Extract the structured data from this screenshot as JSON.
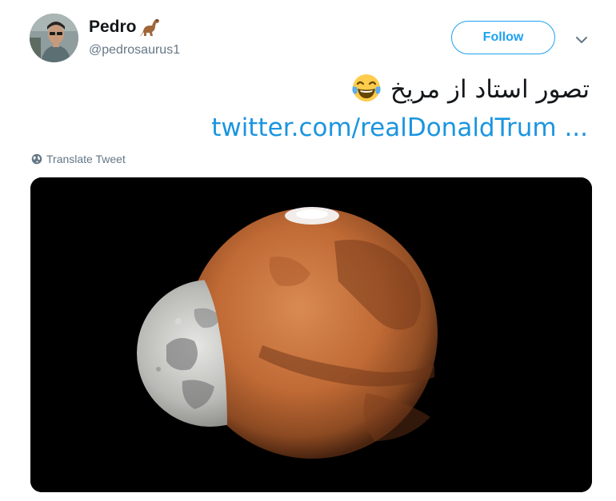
{
  "user": {
    "display_name": "Pedro",
    "name_emoji": "dinosaur-emoji",
    "username": "@pedrosaurus1"
  },
  "follow": {
    "label": "Follow"
  },
  "tweet": {
    "text": "تصور استاد از مریخ",
    "text_emoji": "tears-of-joy-emoji",
    "link": "twitter.com/realDonaldTrum ..."
  },
  "translate": {
    "label": "Translate Tweet",
    "icon": "globe-icon"
  },
  "media": {
    "description_icon": "mars-moon-image"
  },
  "colors": {
    "accent": "#1da1f2",
    "link": "#1b95e0",
    "secondary_text": "#657786"
  }
}
